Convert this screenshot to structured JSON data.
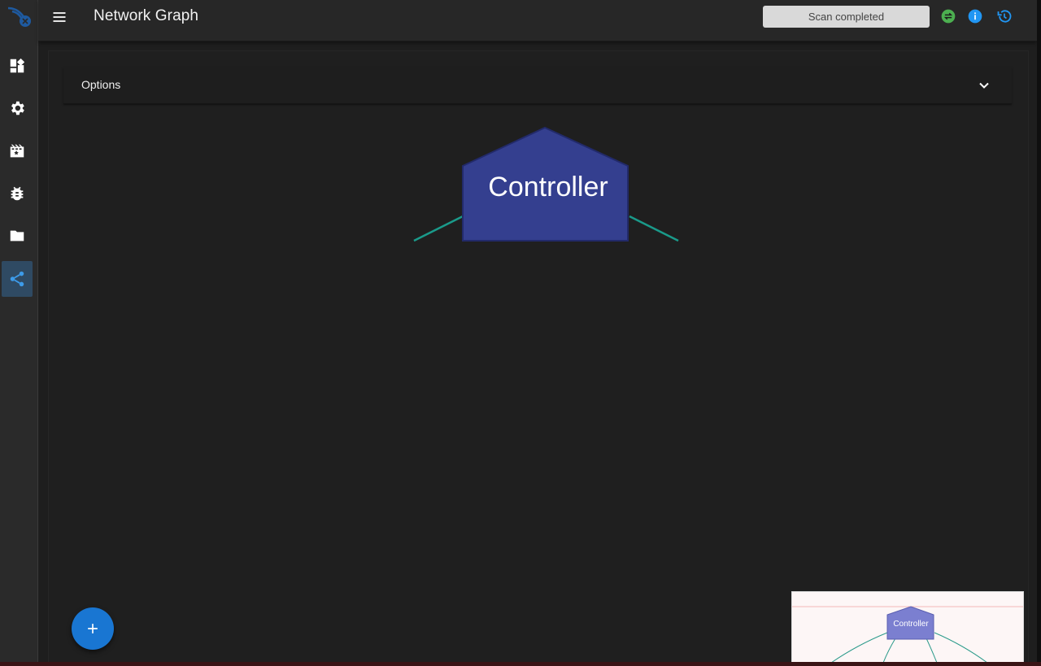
{
  "header": {
    "title": "Network Graph",
    "scan_status": "Scan completed"
  },
  "sidebar": {
    "items": [
      {
        "icon": "dashboard-icon"
      },
      {
        "icon": "gear-icon"
      },
      {
        "icon": "scenes-icon"
      },
      {
        "icon": "bug-icon"
      },
      {
        "icon": "folder-icon"
      },
      {
        "icon": "share-icon",
        "active": true
      }
    ]
  },
  "options": {
    "label": "Options"
  },
  "graph": {
    "node_label": "Controller"
  },
  "minimap": {
    "node_label": "Controller"
  },
  "colors": {
    "accent": "#1976d2",
    "node_fill": "#343f8f",
    "edge": "#1a9a8a",
    "status_ok": "#4caf50",
    "info": "#2196f3"
  }
}
